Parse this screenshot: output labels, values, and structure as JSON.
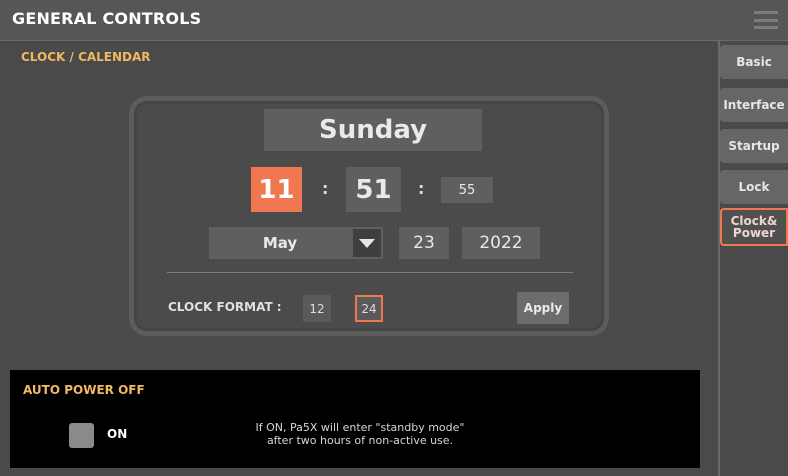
{
  "header": {
    "title": "GENERAL CONTROLS",
    "menu_icon": "hamburger-menu-icon"
  },
  "clock_calendar": {
    "title": "CLOCK / CALENDAR",
    "day_of_week": "Sunday",
    "hour": "11",
    "minute": "51",
    "second": "55",
    "time_separator": ":",
    "month": "May",
    "day": "23",
    "year": "2022",
    "clock_format_label": "CLOCK FORMAT :",
    "format_12": "12",
    "format_24": "24",
    "selected_format": "24",
    "apply_label": "Apply"
  },
  "sidebar": {
    "tabs": [
      {
        "label": "Basic"
      },
      {
        "label": "Interface"
      },
      {
        "label": "Startup"
      },
      {
        "label": "Lock"
      },
      {
        "label": "Clock& Power",
        "active": true
      }
    ]
  },
  "auto_power_off": {
    "title": "AUTO POWER OFF",
    "toggle_label": "ON",
    "checked": false,
    "note_line1": "If ON, Pa5X will enter \"standby mode\"",
    "note_line2": "after two hours of non-active use."
  },
  "colors": {
    "accent": "#f07850",
    "section_title": "#f0b860"
  }
}
